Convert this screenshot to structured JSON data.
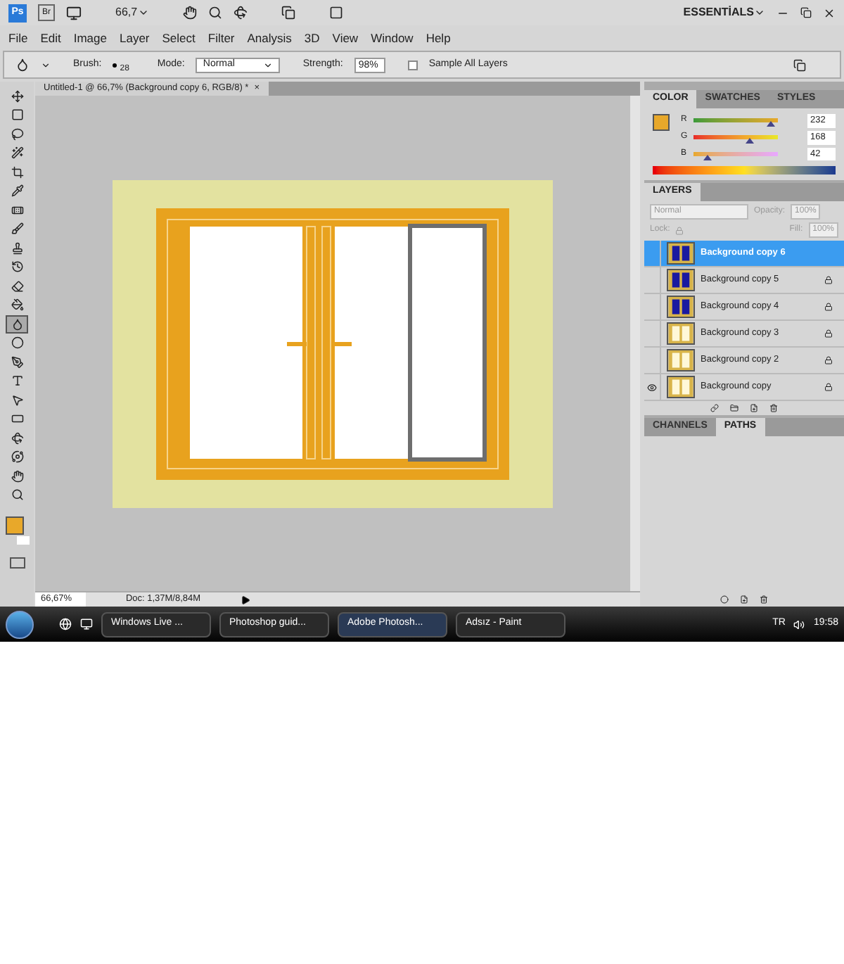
{
  "app_bar": {
    "zoom": "66,7",
    "workspace": "ESSENTİALS",
    "logo": "Ps",
    "bridge": "Br"
  },
  "menu": [
    "File",
    "Edit",
    "Image",
    "Layer",
    "Select",
    "Filter",
    "Analysis",
    "3D",
    "View",
    "Window",
    "Help"
  ],
  "options": {
    "brush_label": "Brush:",
    "brush_size": "28",
    "mode_label": "Mode:",
    "mode": "Normal",
    "strength_label": "Strength:",
    "strength": "98%",
    "sample_all_layers": {
      "label": "Sample All Layers",
      "checked": false
    }
  },
  "tools": [
    {
      "kind": "move",
      "selected": false
    },
    {
      "kind": "marquee",
      "selected": false
    },
    {
      "kind": "lasso",
      "selected": false
    },
    {
      "kind": "wand",
      "selected": false
    },
    {
      "kind": "crop",
      "selected": false
    },
    {
      "kind": "eyedropper",
      "selected": false
    },
    {
      "kind": "heal",
      "selected": false
    },
    {
      "kind": "brush",
      "selected": false
    },
    {
      "kind": "stamp",
      "selected": false
    },
    {
      "kind": "history",
      "selected": false
    },
    {
      "kind": "eraser",
      "selected": false
    },
    {
      "kind": "bucket",
      "selected": false
    },
    {
      "kind": "blur",
      "selected": true
    },
    {
      "kind": "dodge",
      "selected": false
    },
    {
      "kind": "pen",
      "selected": false
    },
    {
      "kind": "type",
      "selected": false
    },
    {
      "kind": "select",
      "selected": false
    },
    {
      "kind": "shape",
      "selected": false
    },
    {
      "kind": "rotate",
      "selected": false
    },
    {
      "kind": "orbit",
      "selected": false
    },
    {
      "kind": "hand",
      "selected": false
    },
    {
      "kind": "zoom",
      "selected": false
    }
  ],
  "foreground": {
    "color": "#e8a82a"
  },
  "document": {
    "title": "Untitled-1 @ 66,7% (Background copy 6, RGB/8) *",
    "close": "×",
    "zoom": "66,67%",
    "doc_info": "Doc: 1,37M/8,84M"
  },
  "color_panel": {
    "tabs": [
      {
        "label": "COLOR",
        "selected": true
      },
      {
        "label": "SWATCHES",
        "selected": false
      },
      {
        "label": "STYLES",
        "selected": false
      }
    ],
    "channels": [
      {
        "label": "R",
        "value": "232",
        "level": 0.91
      },
      {
        "label": "G",
        "value": "168",
        "level": 0.66
      },
      {
        "label": "B",
        "value": "42",
        "level": 0.165
      }
    ]
  },
  "layers_panel": {
    "tab": "LAYERS",
    "blend_mode": "Normal",
    "opacity_label": "Opacity:",
    "opacity": "100%",
    "lock_label": "Lock:",
    "fill_label": "Fill:",
    "fill": "100%",
    "layers": [
      {
        "name": "Background copy 6",
        "selected": true,
        "visible": false,
        "locked": false,
        "kind": "dark"
      },
      {
        "name": "Background copy 5",
        "selected": false,
        "visible": false,
        "locked": true,
        "kind": "dark"
      },
      {
        "name": "Background copy 4",
        "selected": false,
        "visible": false,
        "locked": true,
        "kind": "dark"
      },
      {
        "name": "Background copy 3",
        "selected": false,
        "visible": false,
        "locked": true,
        "kind": "light"
      },
      {
        "name": "Background copy 2",
        "selected": false,
        "visible": false,
        "locked": true,
        "kind": "light"
      },
      {
        "name": "Background copy",
        "selected": false,
        "visible": true,
        "locked": true,
        "kind": "light"
      }
    ]
  },
  "paths_panel": {
    "tabs": [
      {
        "label": "CHANNELS",
        "selected": false
      },
      {
        "label": "PATHS",
        "selected": true
      }
    ]
  },
  "taskbar": {
    "items": [
      {
        "label": "Windows Live ...",
        "selected": false
      },
      {
        "label": "Photoshop guid...",
        "selected": false
      },
      {
        "label": "Adobe Photosh...",
        "selected": true
      },
      {
        "label": "Adsız - Paint",
        "selected": false
      }
    ],
    "language": "TR",
    "clock": "19:58"
  }
}
